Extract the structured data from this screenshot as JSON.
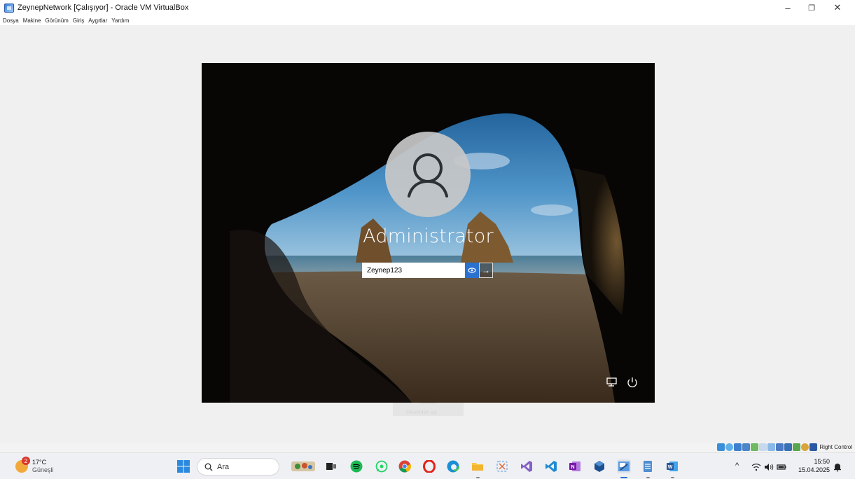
{
  "window": {
    "title": "ZeynepNetwork [Çalışıyor] - Oracle VM VirtualBox",
    "controls": {
      "minimize": "–",
      "restore": "❐",
      "close": "✕"
    }
  },
  "menubar": {
    "items": [
      "Dosya",
      "Makine",
      "Görünüm",
      "Giriş",
      "Aygıtlar",
      "Yardım"
    ]
  },
  "login": {
    "username": "Administrator",
    "password_value": "Zeynep123",
    "submit_arrow": "→"
  },
  "background_hint": {
    "unlock_text": "Resimleri aç"
  },
  "vbox_status": {
    "host_key": "Right Control",
    "icon_colors": [
      "#3b8ed8",
      "#5fb0ea",
      "#3e7fd0",
      "#4a86c8",
      "#6fb864",
      "#8ab8e8",
      "#c7d9ee",
      "#4b7bc4",
      "#3a6fb5",
      "#58a64f",
      "#d9a43a",
      "#2b5aa3"
    ]
  },
  "taskbar": {
    "weather": {
      "temperature": "17°C",
      "condition": "Güneşli",
      "badge": "2"
    },
    "search_placeholder": "Ara",
    "apps": [
      "start-icon",
      "widgets-icon",
      "task-view-icon",
      "spotify-icon",
      "whatsapp-icon",
      "chrome-icon",
      "opera-icon",
      "edge-icon",
      "file-explorer-icon",
      "snipping-icon",
      "visual-studio-icon",
      "vscode-icon",
      "onenote-icon",
      "virtualbox-icon",
      "virtualbox-manager-icon",
      "notepad-icon",
      "word-icon"
    ],
    "tray": {
      "chevron": "^",
      "time": "15:50",
      "date": "15.04.2025"
    }
  },
  "colors": {
    "accent": "#2b71d0",
    "spotify": "#1db954",
    "whatsapp": "#25d366",
    "opera": "#e2231a",
    "word": "#2b579a",
    "vs": "#8661c5",
    "onenote": "#7719aa"
  }
}
